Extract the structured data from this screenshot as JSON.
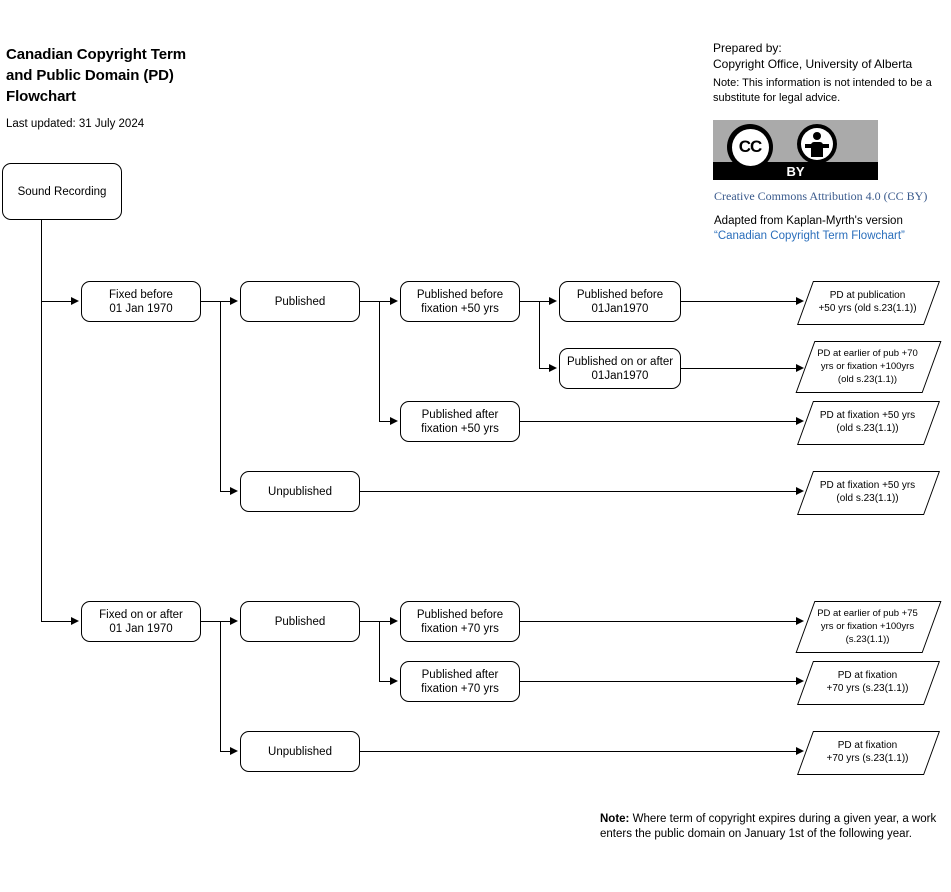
{
  "header": {
    "title": "Canadian Copyright Term and Public Domain (PD) Flowchart",
    "title_line1": "Canadian Copyright Term",
    "title_line2": "and Public Domain (PD)",
    "title_line3": "Flowchart",
    "last_updated": "Last updated: 31 July 2024",
    "prepared_by_label": "Prepared by:",
    "prepared_by_org": "Copyright Office, University of Alberta",
    "disclaimer": "Note:  This information is not intended to be a substitute for legal advice.",
    "license_badge": {
      "cc_text": "CC",
      "by_text": "BY",
      "gray": "#aaaaaa",
      "black": "#000000"
    },
    "license_link": "Creative Commons Attribution 4.0 (CC BY)",
    "license_link_color": "#3a5a8c",
    "adapted_text": "Adapted from Kaplan-Myrth's version",
    "adapted_link": "“Canadian Copyright Term Flowchart”",
    "adapted_link_color": "#2a6ebb"
  },
  "footnote": {
    "bold_label": "Note:",
    "text": " Where term of copyright expires during a given year, a work enters the public domain on January 1st of the following year."
  },
  "chart_data": {
    "type": "flowchart",
    "root": "Sound Recording",
    "nodes": [
      {
        "id": "root",
        "label": "Sound Recording"
      },
      {
        "id": "fixed_pre",
        "label": "Fixed before\n01 Jan 1970"
      },
      {
        "id": "fixed_post",
        "label": "Fixed on or after\n01 Jan 1970"
      },
      {
        "id": "pub_a",
        "label": "Published"
      },
      {
        "id": "unpub_a",
        "label": "Unpublished"
      },
      {
        "id": "pub_b",
        "label": "Published"
      },
      {
        "id": "unpub_b",
        "label": "Unpublished"
      },
      {
        "id": "pbf50",
        "label": "Published before\nfixation +50 yrs"
      },
      {
        "id": "paf50",
        "label": "Published after\nfixation +50 yrs"
      },
      {
        "id": "pb70",
        "label": "Published before \nfixation +70 yrs"
      },
      {
        "id": "pa70",
        "label": "Published after\nfixation +70 yrs"
      },
      {
        "id": "pre1970",
        "label": "Published before\n01Jan1970"
      },
      {
        "id": "post1970",
        "label": "Published on or after\n01Jan1970"
      }
    ],
    "outcomes": [
      {
        "id": "o1",
        "label": "PD at publication\n+50 yrs (old s.23(1.1))"
      },
      {
        "id": "o2",
        "label": "PD at earlier of pub +70\nyrs or fixation +100yrs\n(old s.23(1.1))"
      },
      {
        "id": "o3",
        "label": "PD at fixation +50 yrs\n(old s.23(1.1))"
      },
      {
        "id": "o4",
        "label": "PD at fixation +50 yrs\n(old s.23(1.1))"
      },
      {
        "id": "o5",
        "label": "PD at earlier of pub +75\nyrs or fixation +100yrs\n(s.23(1.1))"
      },
      {
        "id": "o6",
        "label": "PD at fixation\n+70 yrs (s.23(1.1))"
      },
      {
        "id": "o7",
        "label": "PD at fixation\n+70 yrs (s.23(1.1))"
      }
    ]
  },
  "nodes": {
    "root": "Sound Recording",
    "fixed_pre_l1": "Fixed before",
    "fixed_pre_l2": "01 Jan 1970",
    "fixed_post_l1": "Fixed on or after",
    "fixed_post_l2": "01 Jan 1970",
    "published_a": "Published",
    "unpublished_a": "Unpublished",
    "published_b": "Published",
    "unpublished_b": "Unpublished",
    "pbf50_l1": "Published before",
    "pbf50_l2": "fixation +50 yrs",
    "paf50_l1": "Published after",
    "paf50_l2": "fixation +50 yrs",
    "pbf70_l1": "Published before",
    "pbf70_l2": "fixation +70 yrs",
    "paf70_l1": "Published after",
    "paf70_l2": "fixation +70 yrs",
    "pre1970_l1": "Published before",
    "pre1970_l2": "01Jan1970",
    "post1970_l1": "Published on or after",
    "post1970_l2": "01Jan1970"
  },
  "outcomes": {
    "o1_l1": "PD at publication",
    "o1_l2": "+50 yrs (old s.23(1.1))",
    "o2_l1": "PD at earlier of pub +70",
    "o2_l2": "yrs or fixation +100yrs",
    "o2_l3": "(old s.23(1.1))",
    "o3_l1": "PD at fixation +50 yrs",
    "o3_l2": "(old s.23(1.1))",
    "o4_l1": "PD at fixation +50 yrs",
    "o4_l2": "(old s.23(1.1))",
    "o5_l1": "PD at earlier of pub +75",
    "o5_l2": "yrs or fixation +100yrs",
    "o5_l3": "(s.23(1.1))",
    "o6_l1": "PD at fixation",
    "o6_l2": "+70 yrs (s.23(1.1))",
    "o7_l1": "PD at fixation",
    "o7_l2": "+70 yrs (s.23(1.1))"
  }
}
